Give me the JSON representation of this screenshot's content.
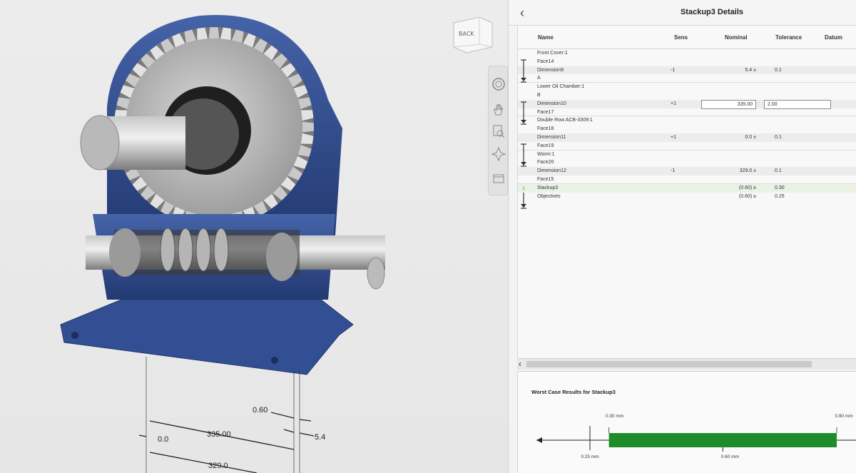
{
  "panel": {
    "title": "Stackup3 Details",
    "back_icon": "chevron-left-icon"
  },
  "viewcube": {
    "face_label": "BACK"
  },
  "nav_tools": [
    "orbit-icon",
    "pan-hand-icon",
    "zoom-window-icon",
    "look-at-icon",
    "display-settings-icon"
  ],
  "table": {
    "headers": {
      "name": "Name",
      "sens": "Sens",
      "nominal": "Nominal",
      "tolerance": "Tolerance",
      "datum": "Datum"
    },
    "groups": [
      {
        "rows": [
          {
            "name": "Front Cover:1"
          },
          {
            "name": "Face14"
          },
          {
            "name": "Dimension9",
            "sens": "-1",
            "nominal": "5.4 ±",
            "tolerance": "0.1"
          },
          {
            "name": "A"
          }
        ]
      },
      {
        "rows": [
          {
            "name": "Lower Oil Chamber:1"
          },
          {
            "name": "B"
          },
          {
            "name": "Dimension10",
            "sens": "+1",
            "nominal": "335.00",
            "tolerance": "2.00",
            "editing": true
          },
          {
            "name": "Face17"
          }
        ]
      },
      {
        "rows": [
          {
            "name": "Double Row ACB-3309:1"
          },
          {
            "name": "Face18"
          },
          {
            "name": "Dimension11",
            "sens": "+1",
            "nominal": "0.0 ±",
            "tolerance": "0.1"
          },
          {
            "name": "Face19"
          }
        ]
      },
      {
        "rows": [
          {
            "name": "Worm:1"
          },
          {
            "name": "Face20"
          },
          {
            "name": "Dimension12",
            "sens": "-1",
            "nominal": "329.0 ±",
            "tolerance": "0.1"
          },
          {
            "name": "Face15"
          }
        ]
      }
    ],
    "summary": [
      {
        "name": "Stackup3",
        "nominal": "(0.60) ≥",
        "tolerance": "0.30"
      },
      {
        "name": "Objectives",
        "nominal": "(0.60) ≥",
        "tolerance": "0.25"
      }
    ]
  },
  "results": {
    "title": "Worst Case Results for Stackup3",
    "min_label": "0.30 mm",
    "max_label": "0.90 mm",
    "objective_label": "0.25 mm",
    "nominal_label": "0.60 mm",
    "range_min": 0.3,
    "range_max": 0.9,
    "objective": 0.25,
    "nominal": 0.6,
    "bar_color": "#1e8c2a"
  },
  "model_dimensions": {
    "d1": "0.60",
    "d2": "335.00",
    "d3": "0.0",
    "d4": "5.4",
    "d5": "329.0"
  },
  "colors": {
    "housing_blue": "#2e4a8a",
    "accent_green": "#1e8c2a"
  }
}
